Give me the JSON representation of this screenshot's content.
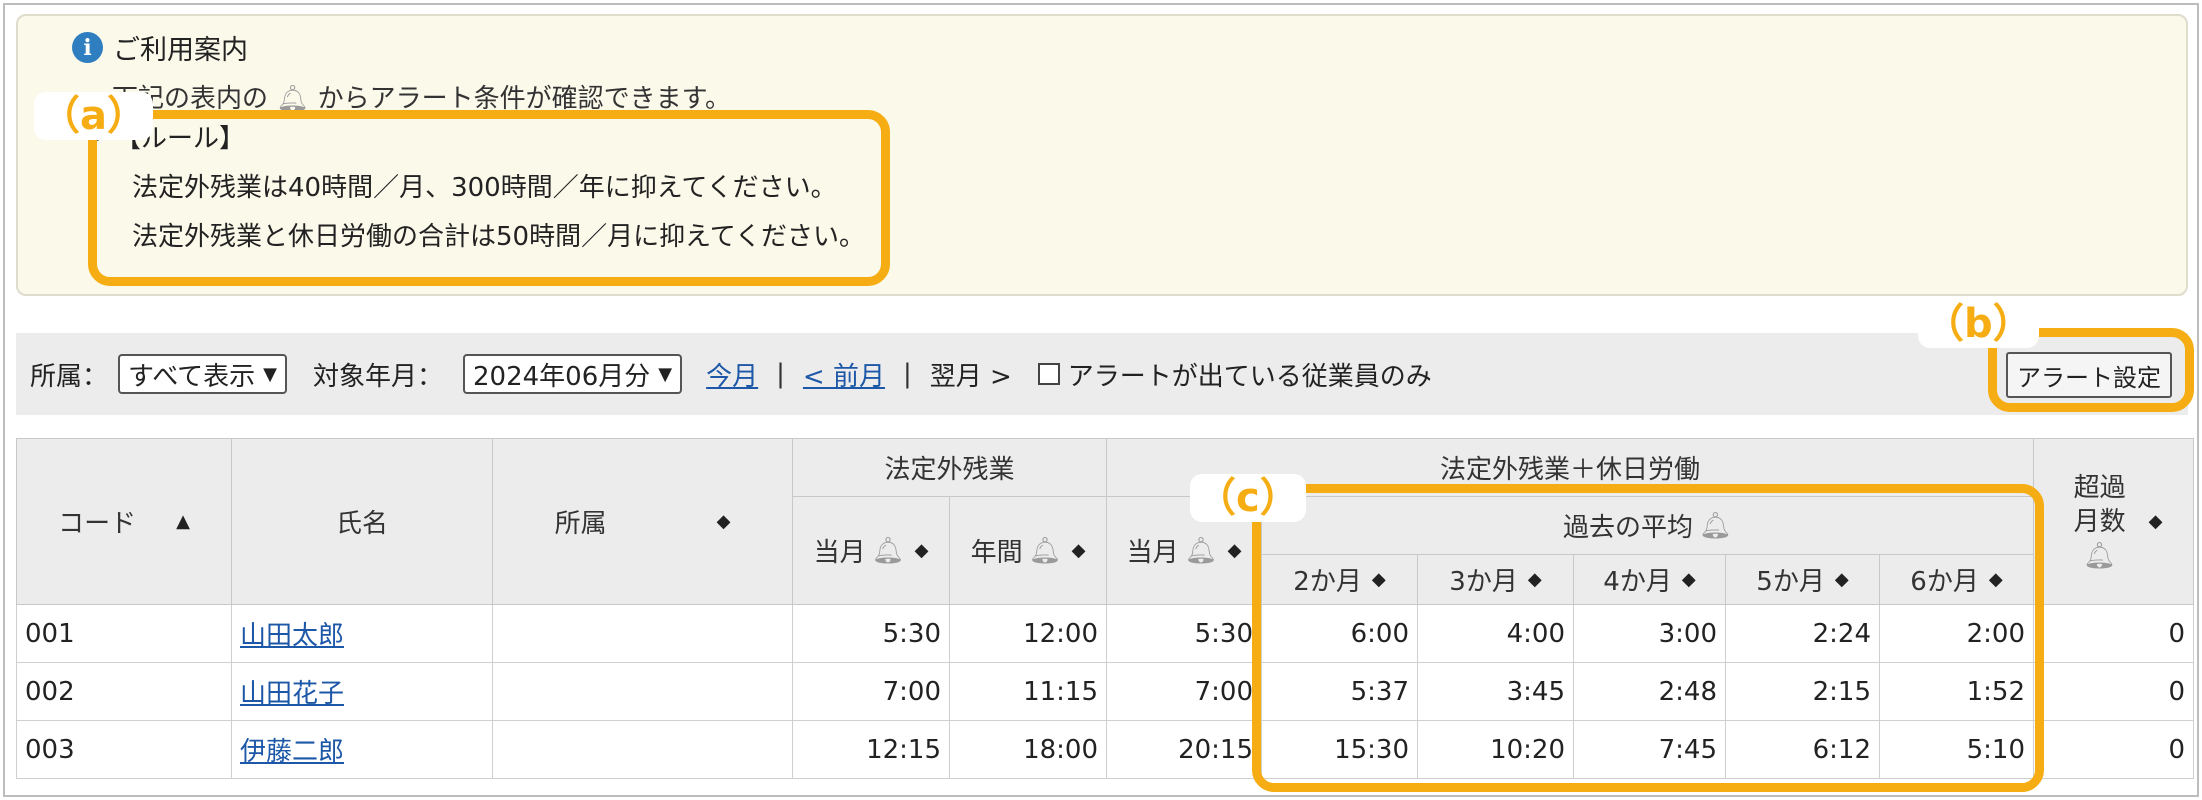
{
  "info": {
    "title": "ご利用案内",
    "icon": "info-icon",
    "description_pre": "下記の表内の",
    "description_post": "からアラート条件が確認できます。",
    "rule_heading": "【ルール】",
    "rule_line1": "法定外残業は40時間／月、300時間／年に抑えてください。",
    "rule_line2": "法定外残業と休日労働の合計は50時間／月に抑えてください。"
  },
  "callouts": {
    "a": "（a）",
    "b": "（b）",
    "c": "（c）",
    "color": "#f6ad14"
  },
  "filter": {
    "affiliation_label": "所属：",
    "affiliation_value": "すべて表示",
    "period_label": "対象年月：",
    "period_value": "2024年06月分",
    "this_month": "今月",
    "prev_month": "< 前月",
    "next_month": "翌月 >",
    "sep": "|",
    "alert_only_label": "アラートが出ている従業員のみ",
    "alert_settings_button": "アラート設定"
  },
  "table": {
    "headers": {
      "code": "コード",
      "name": "氏名",
      "affiliation": "所属",
      "statutory_overtime": "法定外残業",
      "overtime_plus_holiday": "法定外残業＋休日労働",
      "past_average": "過去の平均",
      "excess_months": "超過月数",
      "current_month": "当月",
      "annual": "年間",
      "m2": "2か月",
      "m3": "3か月",
      "m4": "4か月",
      "m5": "5か月",
      "m6": "6か月"
    },
    "rows": [
      {
        "code": "001",
        "name": "山田太郎",
        "affiliation": "",
        "ot_current": "5:30",
        "ot_annual": "12:00",
        "oth_current": "5:30",
        "m2": "6:00",
        "m3": "4:00",
        "m4": "3:00",
        "m5": "2:24",
        "m6": "2:00",
        "excess": "0"
      },
      {
        "code": "002",
        "name": "山田花子",
        "affiliation": "",
        "ot_current": "7:00",
        "ot_annual": "11:15",
        "oth_current": "7:00",
        "m2": "5:37",
        "m3": "3:45",
        "m4": "2:48",
        "m5": "2:15",
        "m6": "1:52",
        "excess": "0"
      },
      {
        "code": "003",
        "name": "伊藤二郎",
        "affiliation": "",
        "ot_current": "12:15",
        "ot_annual": "18:00",
        "oth_current": "20:15",
        "m2": "15:30",
        "m3": "10:20",
        "m4": "7:45",
        "m5": "6:12",
        "m6": "5:10",
        "excess": "0"
      }
    ]
  }
}
